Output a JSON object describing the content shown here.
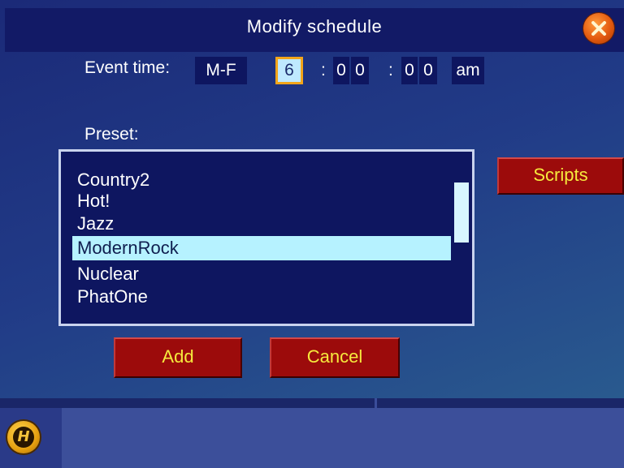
{
  "dialog": {
    "title": "Modify schedule",
    "close_icon": "close-x-icon"
  },
  "event_time": {
    "label": "Event time:",
    "days": "M-F",
    "hour": "6",
    "separator": ":",
    "minute_tens": "0",
    "minute_ones": "0",
    "second_tens": "0",
    "second_ones": "0",
    "ampm": "am"
  },
  "preset": {
    "label": "Preset:",
    "items": [
      "Country2",
      "Hot!",
      "Jazz",
      "ModernRock",
      "Nuclear",
      "PhatOne"
    ],
    "selected": "ModernRock"
  },
  "buttons": {
    "scripts": "Scripts",
    "add": "Add",
    "cancel": "Cancel"
  },
  "status": {
    "logo_letter": "H"
  },
  "colors": {
    "background": "#1c2f78",
    "list_background": "#0e1660",
    "selection": "#b6f2ff",
    "button": "#9c0b0b",
    "button_text": "#f6ea3d",
    "focus": "#f2a51a"
  }
}
